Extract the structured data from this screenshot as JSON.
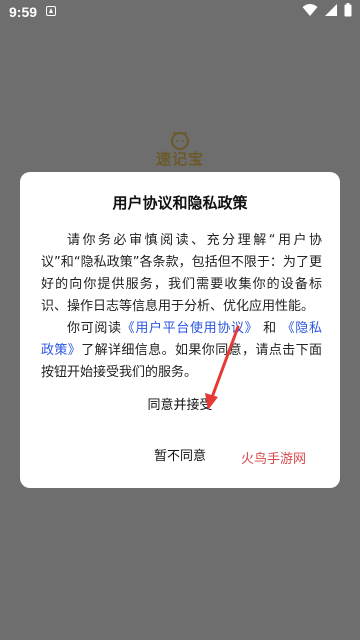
{
  "status_bar": {
    "time": "9:59"
  },
  "background": {
    "app_logo_text": "速记宝"
  },
  "dialog": {
    "title": "用户协议和隐私政策",
    "paragraph1": "请你务必审慎阅读、充分理解“用户协议”和“隐私政策”各条款，包括但不限于：为了更好的向你提供服务，我们需要收集你的设备标识、操作日志等信息用于分析、优化应用性能。",
    "paragraph2_prefix": "你可阅读",
    "link_platform_agreement": "《用户平台使用协议》",
    "paragraph2_and": "和",
    "link_privacy_policy": "《隐私政策》",
    "paragraph2_suffix": "了解详细信息。如果你同意，请点击下面按钮开始接受我们的服务。",
    "agree_label": "同意并接受",
    "disagree_label": "暂不同意"
  },
  "watermark": "火鸟手游网",
  "colors": {
    "link": "#2b56e0",
    "overlay_background": "#6e6e6e",
    "arrow": "#e53935",
    "watermark": "#d64a4a"
  }
}
